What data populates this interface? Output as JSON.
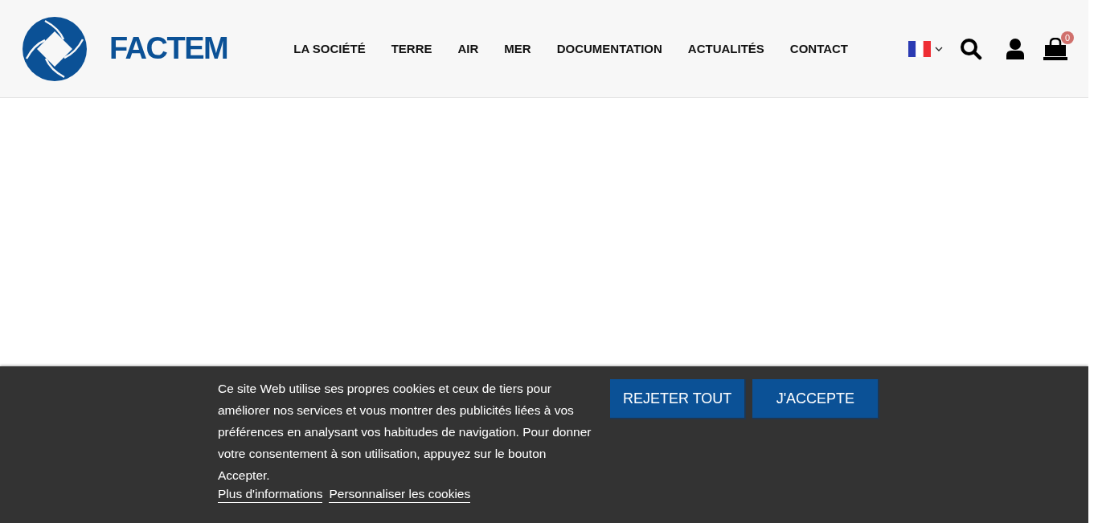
{
  "header": {
    "logo_text": "FACTEM",
    "nav": [
      {
        "label": "LA SOCIÉTÉ"
      },
      {
        "label": "TERRE"
      },
      {
        "label": "AIR"
      },
      {
        "label": "MER"
      },
      {
        "label": "DOCUMENTATION"
      },
      {
        "label": "ACTUALITÉS"
      },
      {
        "label": "CONTACT"
      }
    ],
    "cart_count": "0"
  },
  "cookie_banner": {
    "message": "Ce site Web utilise ses propres cookies et ceux de tiers pour améliorer nos services et vous montrer des publicités liées à vos préférences en analysant vos habitudes de navigation. Pour donner votre consentement à son utilisation, appuyez sur le bouton Accepter.",
    "links": [
      "Plus d'informations",
      "Personnaliser les cookies"
    ],
    "buttons": [
      "REJETER TOUT",
      "J'ACCEPTE"
    ]
  }
}
